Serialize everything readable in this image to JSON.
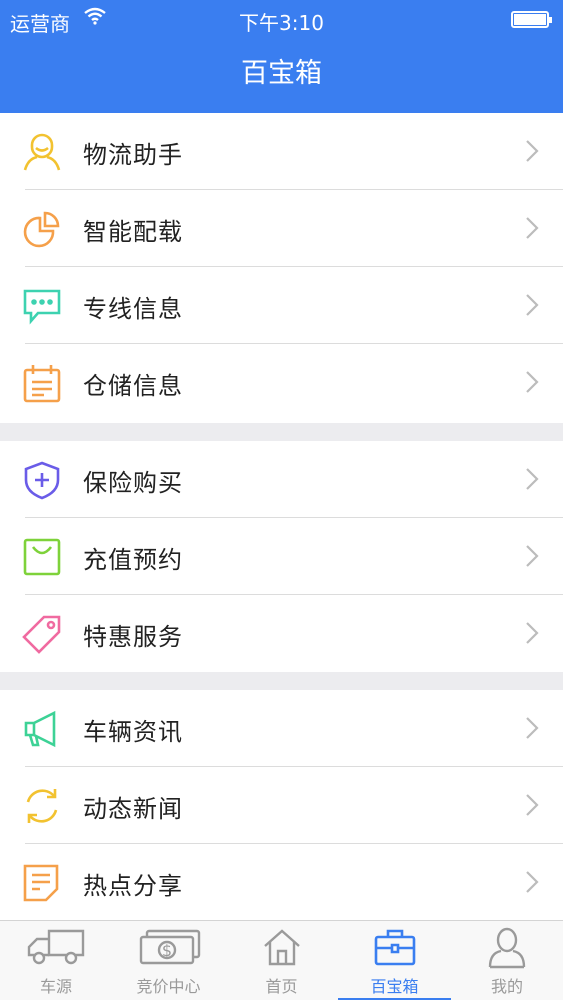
{
  "status": {
    "carrier": "运营商",
    "time": "下午3:10"
  },
  "nav": {
    "title": "百宝箱"
  },
  "sections": [
    [
      {
        "label": "物流助手",
        "icon": "person-icon",
        "color": "#f2c230"
      },
      {
        "label": "智能配载",
        "icon": "pie-chart-icon",
        "color": "#f5a04a"
      },
      {
        "label": "专线信息",
        "icon": "chat-bubble-icon",
        "color": "#3dd2b0"
      },
      {
        "label": "仓储信息",
        "icon": "calendar-icon",
        "color": "#f5a04a"
      }
    ],
    [
      {
        "label": "保险购买",
        "icon": "shield-plus-icon",
        "color": "#6a5ce8"
      },
      {
        "label": "充值预约",
        "icon": "shopping-bag-icon",
        "color": "#7ed23a"
      },
      {
        "label": "特惠服务",
        "icon": "tag-icon",
        "color": "#f06aa0"
      }
    ],
    [
      {
        "label": "车辆资讯",
        "icon": "megaphone-icon",
        "color": "#3dd296"
      },
      {
        "label": "动态新闻",
        "icon": "refresh-icon",
        "color": "#f2c230"
      },
      {
        "label": "热点分享",
        "icon": "note-edit-icon",
        "color": "#f5a04a"
      }
    ]
  ],
  "tabs": [
    {
      "label": "车源",
      "icon": "truck-icon"
    },
    {
      "label": "竞价中心",
      "icon": "money-icon"
    },
    {
      "label": "首页",
      "icon": "home-icon"
    },
    {
      "label": "百宝箱",
      "icon": "toolbox-icon",
      "active": true
    },
    {
      "label": "我的",
      "icon": "user-icon"
    }
  ],
  "colors": {
    "brand": "#3a7ef0",
    "tab_inactive": "#9a9a9a"
  }
}
